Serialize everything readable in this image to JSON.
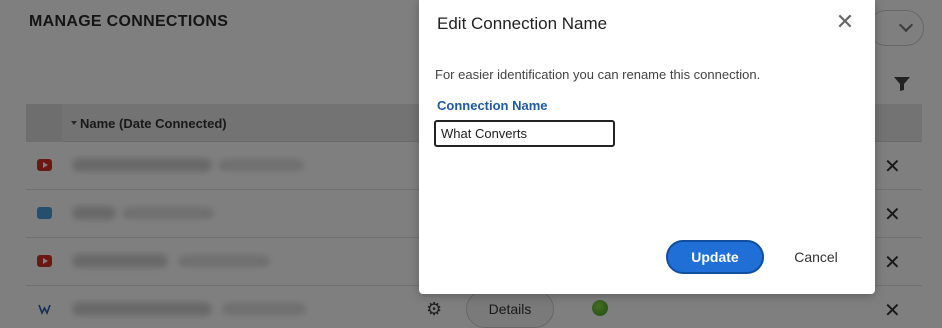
{
  "background": {
    "page_title": "MANAGE CONNECTIONS",
    "table": {
      "name_column_header": "Name (Date Connected)",
      "details_label": "Details",
      "remove_glyph": "✕",
      "settings_glyph": "⚙"
    },
    "rows": [
      {
        "icon": "youtube-icon"
      },
      {
        "icon": "twitter-icon"
      },
      {
        "icon": "youtube-icon"
      },
      {
        "icon": "whatconverts-icon"
      }
    ]
  },
  "modal": {
    "title": "Edit Connection Name",
    "close_glyph": "✕",
    "description": "For easier identification you can rename this connection.",
    "field_label": "Connection Name",
    "field_value": "What Converts",
    "update_label": "Update",
    "cancel_label": "Cancel"
  },
  "colors": {
    "update_button": "#1f6fd6",
    "field_label": "#1f5aa6",
    "status_ok": "#3e9b1c"
  }
}
